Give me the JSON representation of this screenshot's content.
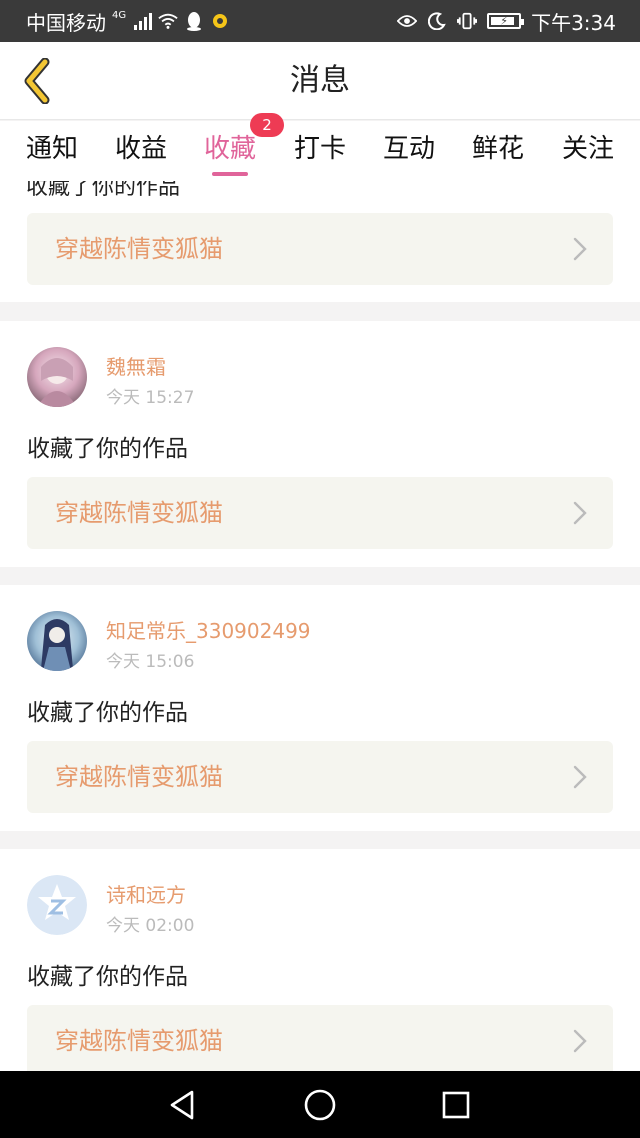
{
  "status_bar": {
    "carrier": "中国移动",
    "network": "4G",
    "time": "下午3:34",
    "battery_level": 0.9,
    "icons": [
      "signal-icon",
      "wifi-icon",
      "qq-icon",
      "notification-icon",
      "eye-icon",
      "moon-icon",
      "vibrate-icon",
      "battery-icon"
    ]
  },
  "header": {
    "title": "消息",
    "back_icon": "chevron-left-icon"
  },
  "tabs": {
    "items": [
      "通知",
      "收益",
      "收藏",
      "打卡",
      "互动",
      "鲜花",
      "关注"
    ],
    "active": "收藏",
    "badge": "2"
  },
  "partial_card": {
    "action_text": "收藏了你的作品",
    "work_title": "穿越陈情变狐猫"
  },
  "messages": [
    {
      "username": "魏無霜",
      "time": "今天 15:27",
      "action_text": "收藏了你的作品",
      "work_title": "穿越陈情变狐猫"
    },
    {
      "username": "知足常乐_330902499",
      "time": "今天 15:06",
      "action_text": "收藏了你的作品",
      "work_title": "穿越陈情变狐猫"
    },
    {
      "username": "诗和远方",
      "time": "今天 02:00",
      "action_text": "收藏了你的作品",
      "work_title": "穿越陈情变狐猫"
    }
  ],
  "nav_bar": {
    "icons": [
      "back-triangle-icon",
      "home-circle-icon",
      "recents-square-icon"
    ]
  },
  "colors": {
    "accent": "#e0649a",
    "badge": "#ee3b54",
    "username": "#e69b6e",
    "back_arrow": "#f3c634",
    "work_bg": "#f5f5ef"
  }
}
